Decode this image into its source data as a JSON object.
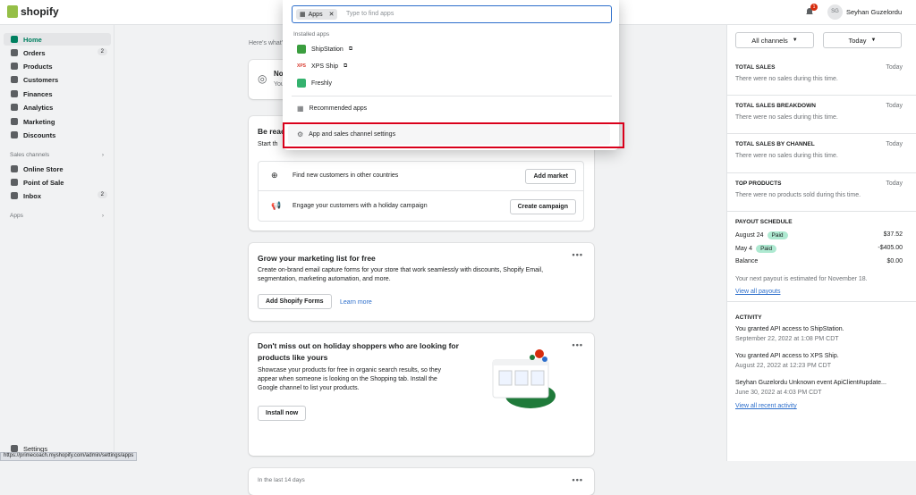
{
  "header": {
    "logo": "shopify",
    "user_initials": "SG",
    "user_name": "Seyhan Guzelordu",
    "notifications": "1"
  },
  "sidebar": {
    "items": [
      {
        "label": "Home",
        "count": ""
      },
      {
        "label": "Orders",
        "count": "2"
      },
      {
        "label": "Products",
        "count": ""
      },
      {
        "label": "Customers",
        "count": ""
      },
      {
        "label": "Finances",
        "count": ""
      },
      {
        "label": "Analytics",
        "count": ""
      },
      {
        "label": "Marketing",
        "count": ""
      },
      {
        "label": "Discounts",
        "count": ""
      }
    ],
    "sales_channels_label": "Sales channels",
    "channels": [
      {
        "label": "Online Store",
        "count": ""
      },
      {
        "label": "Point of Sale",
        "count": ""
      },
      {
        "label": "Inbox",
        "count": "2"
      }
    ],
    "apps_label": "Apps",
    "settings": "Settings"
  },
  "main": {
    "heres_what": "Here's what'",
    "card_no": {
      "title": "No",
      "sub": "You"
    },
    "card_ready": {
      "title": "Be reac",
      "sub": "Start th",
      "rows": [
        {
          "text": "Find new customers in other countries",
          "button": "Add market"
        },
        {
          "text": "Engage your customers with a holiday campaign",
          "button": "Create campaign"
        }
      ]
    },
    "card_marketing": {
      "title": "Grow your marketing list for free",
      "body": "Create on-brand email capture forms for your store that work seamlessly with discounts, Shopify Email, segmentation, marketing automation, and more.",
      "button": "Add Shopify Forms",
      "link": "Learn more"
    },
    "card_holiday": {
      "title": "Don't miss out on holiday shoppers who are looking for products like yours",
      "body": "Showcase your products for free in organic search results, so they appear when someone is looking on the Shopping tab. Install the Google channel to list your products.",
      "button": "Install now"
    },
    "card_last": {
      "text": "In the last 14 days"
    }
  },
  "popup": {
    "chip": "Apps",
    "placeholder": "Type to find apps",
    "installed_label": "Installed apps",
    "apps": [
      {
        "name": "ShipStation",
        "color": "#3b9e3f"
      },
      {
        "name": "XPS Ship",
        "color": "#d83a2e"
      },
      {
        "name": "Freshly",
        "color": "#34b26e"
      }
    ],
    "recommended": "Recommended apps",
    "settings": "App and sales channel settings"
  },
  "right": {
    "channels_dd": "All channels",
    "date_dd": "Today",
    "sections": [
      {
        "title": "TOTAL SALES",
        "day": "Today",
        "text": "There were no sales during this time."
      },
      {
        "title": "TOTAL SALES BREAKDOWN",
        "day": "Today",
        "text": "There were no sales during this time."
      },
      {
        "title": "TOTAL SALES BY CHANNEL",
        "day": "Today",
        "text": "There were no sales during this time."
      },
      {
        "title": "TOP PRODUCTS",
        "day": "Today",
        "text": "There were no products sold during this time."
      }
    ],
    "payout": {
      "title": "PAYOUT SCHEDULE",
      "rows": [
        {
          "date": "August 24",
          "status": "Paid",
          "amount": "$37.52"
        },
        {
          "date": "May 4",
          "status": "Paid",
          "amount": "-$405.00"
        }
      ],
      "balance_label": "Balance",
      "balance": "$0.00",
      "next": "Your next payout is estimated for November 18.",
      "link": "View all payouts"
    },
    "activity": {
      "title": "ACTIVITY",
      "items": [
        {
          "text": "You granted API access to ShipStation.",
          "date": "September 22, 2022 at 1:08 PM CDT"
        },
        {
          "text": "You granted API access to XPS Ship.",
          "date": "August 22, 2022 at 12:23 PM CDT"
        },
        {
          "text": "Seyhan Guzelordu Unknown event ApiClient#update...",
          "date": "June 30, 2022 at 4:03 PM CDT"
        }
      ],
      "link": "View all recent activity"
    }
  },
  "statusbar": "https://primecoach.myshopify.com/admin/settings/apps"
}
